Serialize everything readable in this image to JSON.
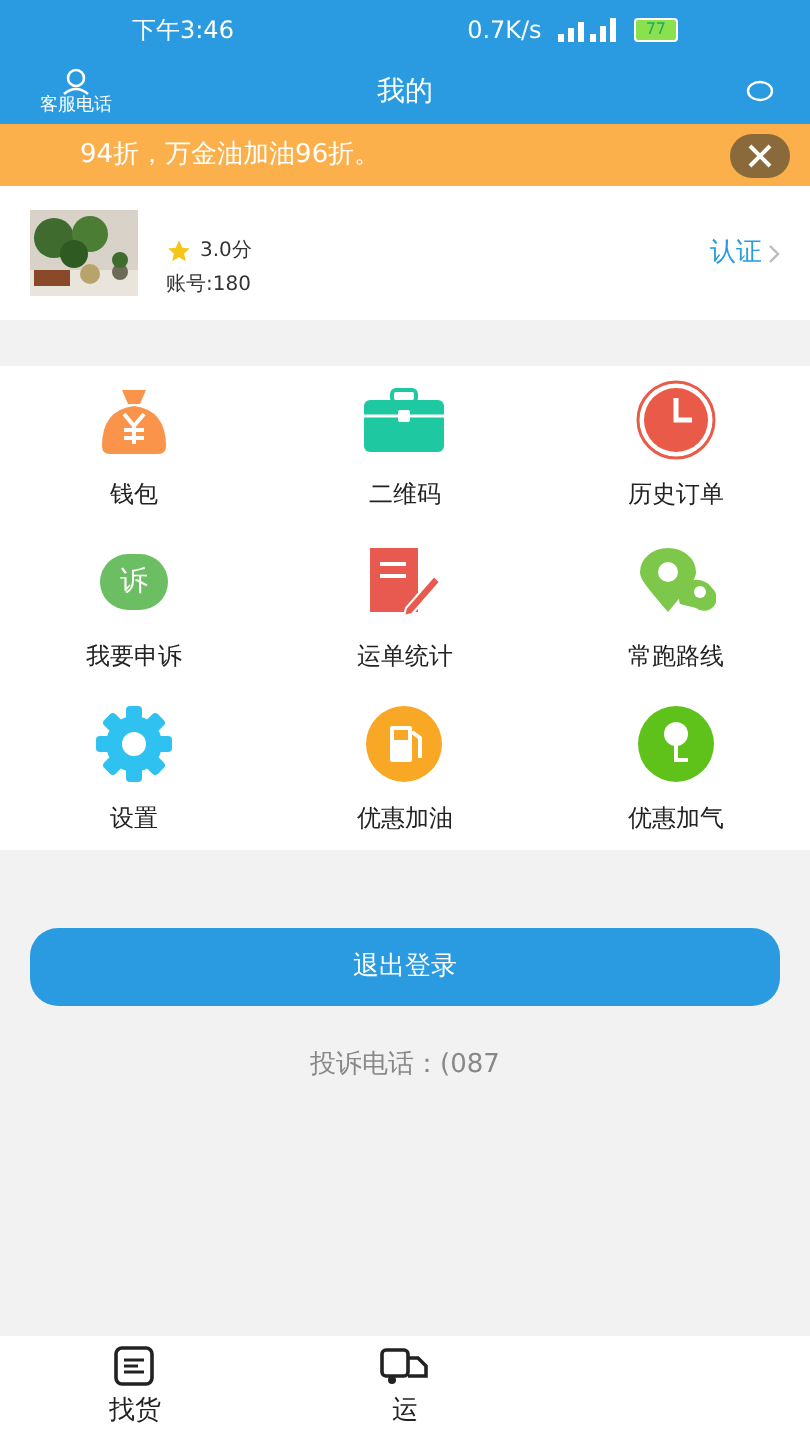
{
  "status_bar": {
    "time": "下午3:46",
    "speed": "0.7K/s",
    "battery": "77"
  },
  "header": {
    "left_label": "客服电话",
    "title": "我的"
  },
  "banner": {
    "text": "94折，万金油加油96折。"
  },
  "profile": {
    "score": "3.0分",
    "account": "账号:180",
    "verify": "认证"
  },
  "grid": [
    {
      "label": "钱包",
      "kind": "wallet"
    },
    {
      "label": "二维码",
      "kind": "briefcase"
    },
    {
      "label": "历史订单",
      "kind": "clock"
    },
    {
      "label": "我要申诉",
      "kind": "appeal",
      "glyph": "诉"
    },
    {
      "label": "运单统计",
      "kind": "report"
    },
    {
      "label": "常跑路线",
      "kind": "route"
    },
    {
      "label": "设置",
      "kind": "gear"
    },
    {
      "label": "优惠加油",
      "kind": "fuel"
    },
    {
      "label": "优惠加气",
      "kind": "gas"
    }
  ],
  "logout_button": "退出登录",
  "complaint_phone": "投诉电话：(087",
  "tabs": [
    {
      "label": "找货",
      "kind": "list",
      "selected": false
    },
    {
      "label": "运",
      "kind": "truck",
      "selected": false
    }
  ]
}
